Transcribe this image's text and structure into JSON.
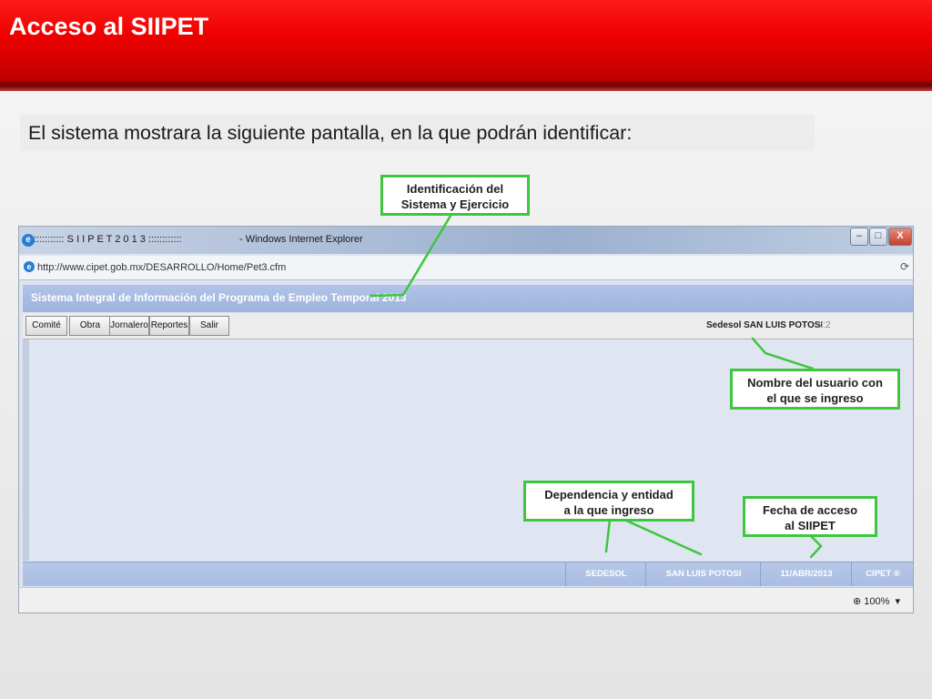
{
  "slide": {
    "title": "Acceso al SIIPET",
    "intro": "El sistema mostrara la siguiente pantalla, en la que podrán identificar:"
  },
  "callouts": {
    "system_id": [
      "Identificación del",
      "Sistema y Ejercicio"
    ],
    "user_name": [
      "Nombre del usuario con",
      "el que se ingreso"
    ],
    "dependency": [
      "Dependencia y entidad",
      "a la que ingreso"
    ],
    "access_date": [
      "Fecha de acceso",
      "al SIIPET"
    ]
  },
  "browser": {
    "window_title": "::::::::::: S I I P E T 2 0 1 3 ::::::::::::",
    "window_title_suffix": "- Windows Internet Explorer",
    "url": "http://www.cipet.gob.mx/DESARROLLO/Home/Pet3.cfm",
    "zoom": "100%",
    "controls": {
      "minimize": "–",
      "maximize": "□",
      "close": "X"
    }
  },
  "app": {
    "header": "Sistema Integral de Información del Programa de Empleo Temporal 2013",
    "toolbar": [
      "Comité",
      "Obra",
      "Jornalero",
      "Reportes",
      "Salir"
    ],
    "user": "Sedesol SAN LUIS POTOSI",
    "user_suffix": "N:2",
    "status": {
      "dependency": "SEDESOL",
      "state": "SAN LUIS POTOSI",
      "date": "11/ABR/2013",
      "brand": "CIPET ®"
    }
  },
  "colors": {
    "title_red": "#e00000",
    "callout_border": "#3ec63e",
    "app_header": "#a9bde2"
  }
}
